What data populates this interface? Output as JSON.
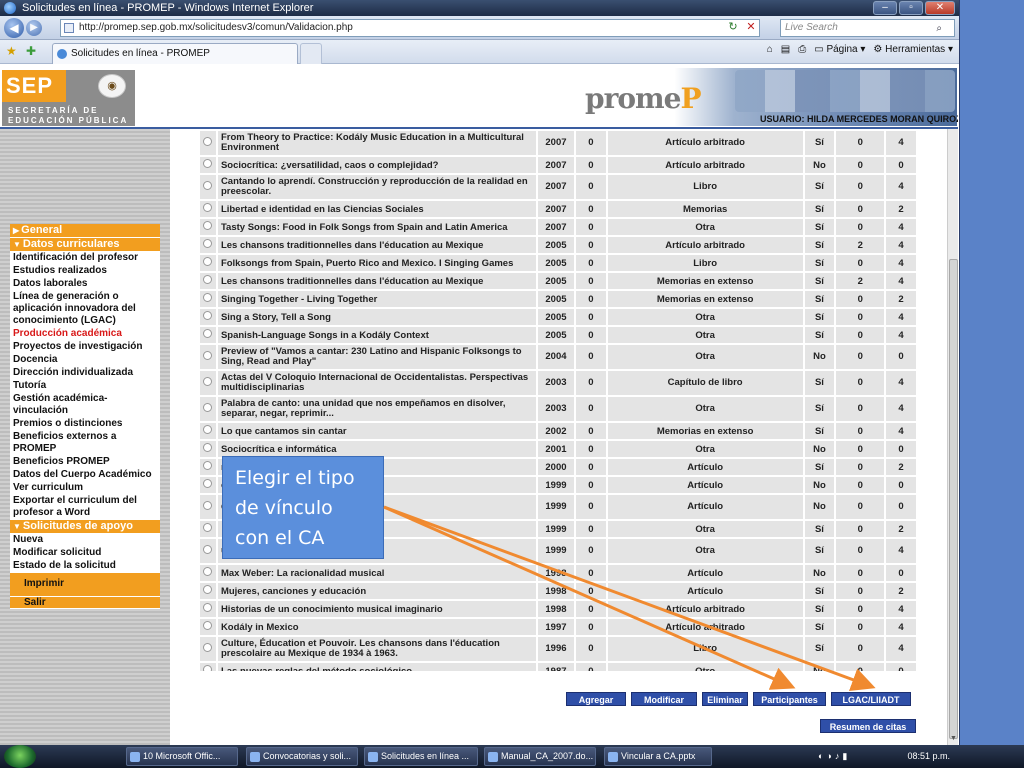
{
  "window": {
    "title": "Solicitudes en línea - PROMEP - Windows Internet Explorer",
    "url": "http://promep.sep.gob.mx/solicitudesv3/comun/Validacion.php",
    "search_placeholder": "Live Search",
    "tab_label": "Solicitudes en línea - PROMEP",
    "cmd_pagina": "Página",
    "cmd_herramientas": "Herramientas"
  },
  "header": {
    "sep_text": "SEP",
    "sep_subtitle_1": "SECRETARÍA DE",
    "sep_subtitle_2": "EDUCACIÓN PÚBLICA",
    "promep_logo_a": "prome",
    "promep_logo_b": "P",
    "user_label": "USUARIO: HILDA MERCEDES MORAN QUIROZ"
  },
  "sidebar": {
    "items": [
      {
        "label": "General",
        "type": "section"
      },
      {
        "label": "Datos curriculares",
        "type": "section"
      },
      {
        "label": "Identificación del profesor",
        "type": "item"
      },
      {
        "label": "Estudios realizados",
        "type": "item"
      },
      {
        "label": "Datos laborales",
        "type": "item"
      },
      {
        "label": "Línea de generación o aplicación innovadora del conocimiento (LGAC)",
        "type": "item"
      },
      {
        "label": "Producción académica",
        "type": "active"
      },
      {
        "label": "Proyectos de investigación",
        "type": "item"
      },
      {
        "label": "Docencia",
        "type": "item"
      },
      {
        "label": "Dirección individualizada",
        "type": "item"
      },
      {
        "label": "Tutoría",
        "type": "item"
      },
      {
        "label": "Gestión académica-vinculación",
        "type": "item"
      },
      {
        "label": "Premios o distinciones",
        "type": "item"
      },
      {
        "label": "Beneficios externos a PROMEP",
        "type": "item"
      },
      {
        "label": "Beneficios PROMEP",
        "type": "item"
      },
      {
        "label": "Datos del Cuerpo Académico",
        "type": "item"
      },
      {
        "label": "Ver curriculum",
        "type": "item"
      },
      {
        "label": "Exportar el curriculum del profesor a Word",
        "type": "item"
      },
      {
        "label": "Solicitudes de apoyo",
        "type": "section"
      },
      {
        "label": "Nueva",
        "type": "item"
      },
      {
        "label": "Modificar solicitud",
        "type": "item"
      },
      {
        "label": "Estado de la solicitud",
        "type": "item"
      },
      {
        "label": "Imprimir",
        "type": "print"
      },
      {
        "label": "Salir",
        "type": "exit"
      }
    ]
  },
  "table": {
    "rows": [
      {
        "title": "From Theory to Practice: Kodály Music Education in a Multicultural Environment",
        "year": "2007",
        "n": "0",
        "type": "Artículo arbitrado",
        "flag": "Sí",
        "a": "0",
        "b": "4",
        "tall": true
      },
      {
        "title": "Sociocrítica: ¿versatilidad, caos o complejidad?",
        "year": "2007",
        "n": "0",
        "type": "Artículo arbitrado",
        "flag": "No",
        "a": "0",
        "b": "0"
      },
      {
        "title": "Cantando lo aprendí. Construcción y reproducción de la realidad en preescolar.",
        "year": "2007",
        "n": "0",
        "type": "Libro",
        "flag": "Sí",
        "a": "0",
        "b": "4",
        "tall": true
      },
      {
        "title": "Libertad e identidad en las Ciencias Sociales",
        "year": "2007",
        "n": "0",
        "type": "Memorias",
        "flag": "Sí",
        "a": "0",
        "b": "2"
      },
      {
        "title": "Tasty Songs: Food in Folk Songs from Spain and Latin America",
        "year": "2007",
        "n": "0",
        "type": "Otra",
        "flag": "Sí",
        "a": "0",
        "b": "4"
      },
      {
        "title": "Les chansons traditionnelles dans l'éducation au Mexique",
        "year": "2005",
        "n": "0",
        "type": "Artículo arbitrado",
        "flag": "Sí",
        "a": "2",
        "b": "4"
      },
      {
        "title": "Folksongs from Spain, Puerto Rico and Mexico. I Singing Games",
        "year": "2005",
        "n": "0",
        "type": "Libro",
        "flag": "Sí",
        "a": "0",
        "b": "4"
      },
      {
        "title": "Les chansons traditionnelles dans l'éducation au Mexique",
        "year": "2005",
        "n": "0",
        "type": "Memorias en extenso",
        "flag": "Sí",
        "a": "2",
        "b": "4"
      },
      {
        "title": "Singing Together - Living Together",
        "year": "2005",
        "n": "0",
        "type": "Memorias en extenso",
        "flag": "Sí",
        "a": "0",
        "b": "2"
      },
      {
        "title": "Sing a Story, Tell a Song",
        "year": "2005",
        "n": "0",
        "type": "Otra",
        "flag": "Sí",
        "a": "0",
        "b": "4"
      },
      {
        "title": "Spanish-Language Songs in a Kodály Context",
        "year": "2005",
        "n": "0",
        "type": "Otra",
        "flag": "Sí",
        "a": "0",
        "b": "4"
      },
      {
        "title": "Preview of \"Vamos a cantar: 230 Latino and Hispanic Folksongs to Sing, Read and Play\"",
        "year": "2004",
        "n": "0",
        "type": "Otra",
        "flag": "No",
        "a": "0",
        "b": "0",
        "tall": true
      },
      {
        "title": "Actas del V Coloquio Internacional de Occidentalistas. Perspectivas multidisciplinarias",
        "year": "2003",
        "n": "0",
        "type": "Capítulo de libro",
        "flag": "Sí",
        "a": "0",
        "b": "4",
        "tall": true
      },
      {
        "title": "Palabra de canto: una unidad que nos empeñamos en disolver, separar, negar, reprimir...",
        "year": "2003",
        "n": "0",
        "type": "Otra",
        "flag": "Sí",
        "a": "0",
        "b": "4",
        "tall": true
      },
      {
        "title": "Lo que cantamos sin cantar",
        "year": "2002",
        "n": "0",
        "type": "Memorias en extenso",
        "flag": "Sí",
        "a": "0",
        "b": "4"
      },
      {
        "title": "Sociocrítica e informática",
        "year": "2001",
        "n": "0",
        "type": "Otra",
        "flag": "No",
        "a": "0",
        "b": "0"
      },
      {
        "title": "rota",
        "year": "2000",
        "n": "0",
        "type": "Artículo",
        "flag": "Sí",
        "a": "0",
        "b": "2"
      },
      {
        "title": "os hombres del mundo",
        "year": "1999",
        "n": "0",
        "type": "Artículo",
        "flag": "No",
        "a": "0",
        "b": "0"
      },
      {
        "title": "que las mujeres cantan a los",
        "year": "1999",
        "n": "0",
        "type": "Artículo",
        "flag": "No",
        "a": "0",
        "b": "0",
        "tall": true
      },
      {
        "title": "",
        "year": "1999",
        "n": "0",
        "type": "Otra",
        "flag": "Sí",
        "a": "0",
        "b": "2"
      },
      {
        "title": "urgois, Music and the",
        "year": "1999",
        "n": "0",
        "type": "Otra",
        "flag": "Sí",
        "a": "0",
        "b": "4",
        "tall": true
      },
      {
        "title": "Max Weber: La racionalidad musical",
        "year": "1998",
        "n": "0",
        "type": "Artículo",
        "flag": "No",
        "a": "0",
        "b": "0"
      },
      {
        "title": "Mujeres, canciones y educación",
        "year": "1998",
        "n": "0",
        "type": "Artículo",
        "flag": "Sí",
        "a": "0",
        "b": "2"
      },
      {
        "title": "Historias de un conocimiento musical imaginario",
        "year": "1998",
        "n": "0",
        "type": "Artículo arbitrado",
        "flag": "Sí",
        "a": "0",
        "b": "4"
      },
      {
        "title": "Kodály in Mexico",
        "year": "1997",
        "n": "0",
        "type": "Artículo arbitrado",
        "flag": "Sí",
        "a": "0",
        "b": "4"
      },
      {
        "title": "Culture, Éducation et Pouvoir. Les chansons dans l'éducation prescolaire au Mexique de 1934 à 1963.",
        "year": "1996",
        "n": "0",
        "type": "Libro",
        "flag": "Sí",
        "a": "0",
        "b": "4",
        "tall": true
      },
      {
        "title": "Las nuevas reglas del método sociológico",
        "year": "1987",
        "n": "0",
        "type": "Otro",
        "flag": "No",
        "a": "0",
        "b": "0"
      }
    ]
  },
  "buttons": {
    "agregar": "Agregar",
    "modificar": "Modificar",
    "eliminar": "Eliminar",
    "participantes": "Participantes",
    "lgac": "LGAC/LIIADT",
    "resumen": "Resumen de citas"
  },
  "callout": {
    "line1": "Elegir el tipo",
    "line2": "de vínculo",
    "line3": "con el CA"
  },
  "taskbar": {
    "items": [
      "10 Microsoft Offic...",
      "Convocatorias y soli...",
      "Solicitudes en línea ...",
      "Manual_CA_2007.do...",
      "Vincular a CA.pptx"
    ],
    "time": "08:51 p.m."
  }
}
